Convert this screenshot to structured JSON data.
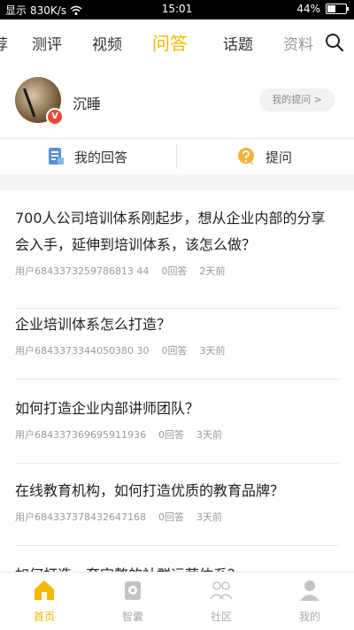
{
  "status_bar": {
    "carrier": "显示",
    "speed": "830K/s",
    "time": "15:01",
    "battery": "44%",
    "battery_level": 0.44
  },
  "nav": {
    "tabs": [
      {
        "label": "荐"
      },
      {
        "label": "测评"
      },
      {
        "label": "视频"
      },
      {
        "label": "问答"
      },
      {
        "label": "话题"
      },
      {
        "label": "资料"
      }
    ],
    "active_tab": "问答"
  },
  "profile": {
    "username": "沉睡",
    "badge": "V",
    "my_questions_label": "我的提问 >"
  },
  "actions": {
    "my_answers": "我的回答",
    "ask": "提问"
  },
  "feed": [
    {
      "question": "700人公司培训体系刚起步，想从企业内部的分享会入手，延伸到培训体系，该怎么做？",
      "user": "用户6843373259786813 44",
      "answers": "0回答",
      "time": "2天前"
    },
    {
      "question": "企业培训体系怎么打造？",
      "user": "用户6843373344050380 30",
      "answers": "0回答",
      "time": "3天前"
    },
    {
      "question": "如何打造企业内部讲师团队？",
      "user": "用户684337369695911936",
      "answers": "0回答",
      "time": "3天前"
    },
    {
      "question": "在线教育机构，如何打造优质的教育品牌？",
      "user": "用户684337378432647168",
      "answers": "0回答",
      "time": "3天前"
    },
    {
      "question": "如何打造一套完整的社群运营体系？",
      "user": "",
      "answers": "",
      "time": ""
    }
  ],
  "bottom_nav": [
    {
      "label": "首页"
    },
    {
      "label": "智囊"
    },
    {
      "label": "社区"
    },
    {
      "label": "我的"
    }
  ],
  "colors": {
    "accent": "#f5b800",
    "badge": "#e8483c"
  }
}
